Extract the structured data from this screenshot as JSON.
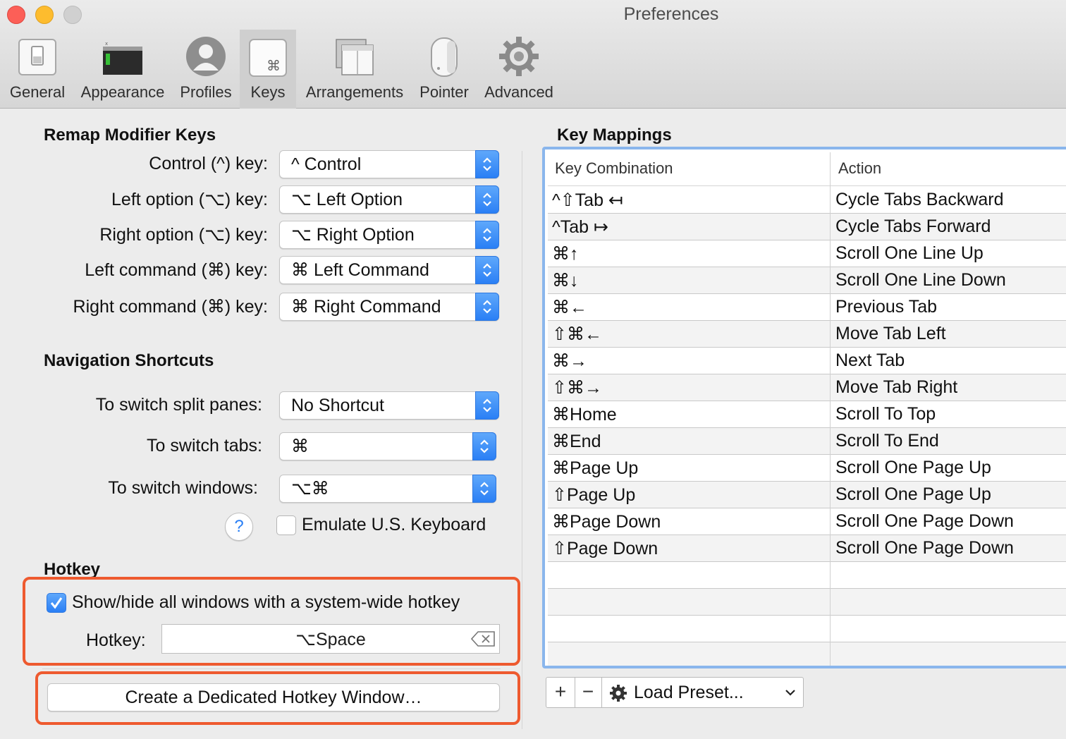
{
  "window": {
    "title": "Preferences"
  },
  "toolbar": {
    "tabs": [
      {
        "label": "General",
        "icon": "switch-icon"
      },
      {
        "label": "Appearance",
        "icon": "terminal-window-icon"
      },
      {
        "label": "Profiles",
        "icon": "user-silhouette-icon"
      },
      {
        "label": "Keys",
        "icon": "command-key-icon",
        "active": true
      },
      {
        "label": "Arrangements",
        "icon": "windows-stack-icon"
      },
      {
        "label": "Pointer",
        "icon": "mouse-icon"
      },
      {
        "label": "Advanced",
        "icon": "gear-icon"
      }
    ]
  },
  "remap": {
    "title": "Remap Modifier Keys",
    "rows": [
      {
        "label": "Control (^) key:",
        "value": "^ Control"
      },
      {
        "label": "Left option (⌥) key:",
        "value": "⌥ Left Option"
      },
      {
        "label": "Right option (⌥) key:",
        "value": "⌥ Right Option"
      },
      {
        "label": "Left command (⌘) key:",
        "value": "⌘ Left Command"
      },
      {
        "label": "Right command (⌘) key:",
        "value": "⌘ Right Command"
      }
    ]
  },
  "navigation": {
    "title": "Navigation Shortcuts",
    "rows": [
      {
        "label": "To switch split panes:",
        "value": "No Shortcut"
      },
      {
        "label": "To switch tabs:",
        "value": "⌘"
      },
      {
        "label": "To switch windows:",
        "value": "⌥⌘"
      }
    ],
    "help_glyph": "?",
    "emulate_label": "Emulate U.S. Keyboard",
    "emulate_checked": false
  },
  "hotkey": {
    "title": "Hotkey",
    "show_hide_label": "Show/hide all windows with a system-wide hotkey",
    "show_hide_checked": true,
    "field_label": "Hotkey:",
    "field_value": "⌥Space",
    "dedicated_button": "Create a Dedicated Hotkey Window…"
  },
  "key_mappings": {
    "title": "Key Mappings",
    "columns": [
      "Key Combination",
      "Action"
    ],
    "rows": [
      {
        "key": "^⇧Tab ↤",
        "action": "Cycle Tabs Backward"
      },
      {
        "key": "^Tab ↦",
        "action": "Cycle Tabs Forward"
      },
      {
        "key": "⌘↑",
        "action": "Scroll One Line Up"
      },
      {
        "key": "⌘↓",
        "action": "Scroll One Line Down"
      },
      {
        "key": "⌘←",
        "action": "Previous Tab"
      },
      {
        "key": "⇧⌘←",
        "action": "Move Tab Left"
      },
      {
        "key": "⌘→",
        "action": "Next Tab"
      },
      {
        "key": "⇧⌘→",
        "action": "Move Tab Right"
      },
      {
        "key": "⌘Home",
        "action": "Scroll To Top"
      },
      {
        "key": "⌘End",
        "action": "Scroll To End"
      },
      {
        "key": "⌘Page Up",
        "action": "Scroll One Page Up"
      },
      {
        "key": "⇧Page Up",
        "action": "Scroll One Page Up"
      },
      {
        "key": "⌘Page Down",
        "action": "Scroll One Page Down"
      },
      {
        "key": "⇧Page Down",
        "action": "Scroll One Page Down"
      }
    ],
    "add_glyph": "+",
    "remove_glyph": "−",
    "preset_label": "Load Preset..."
  },
  "colors": {
    "accent": "#2a7ff5",
    "highlight_box": "#ee5a2f",
    "table_focus_ring": "#8ab6ec"
  }
}
